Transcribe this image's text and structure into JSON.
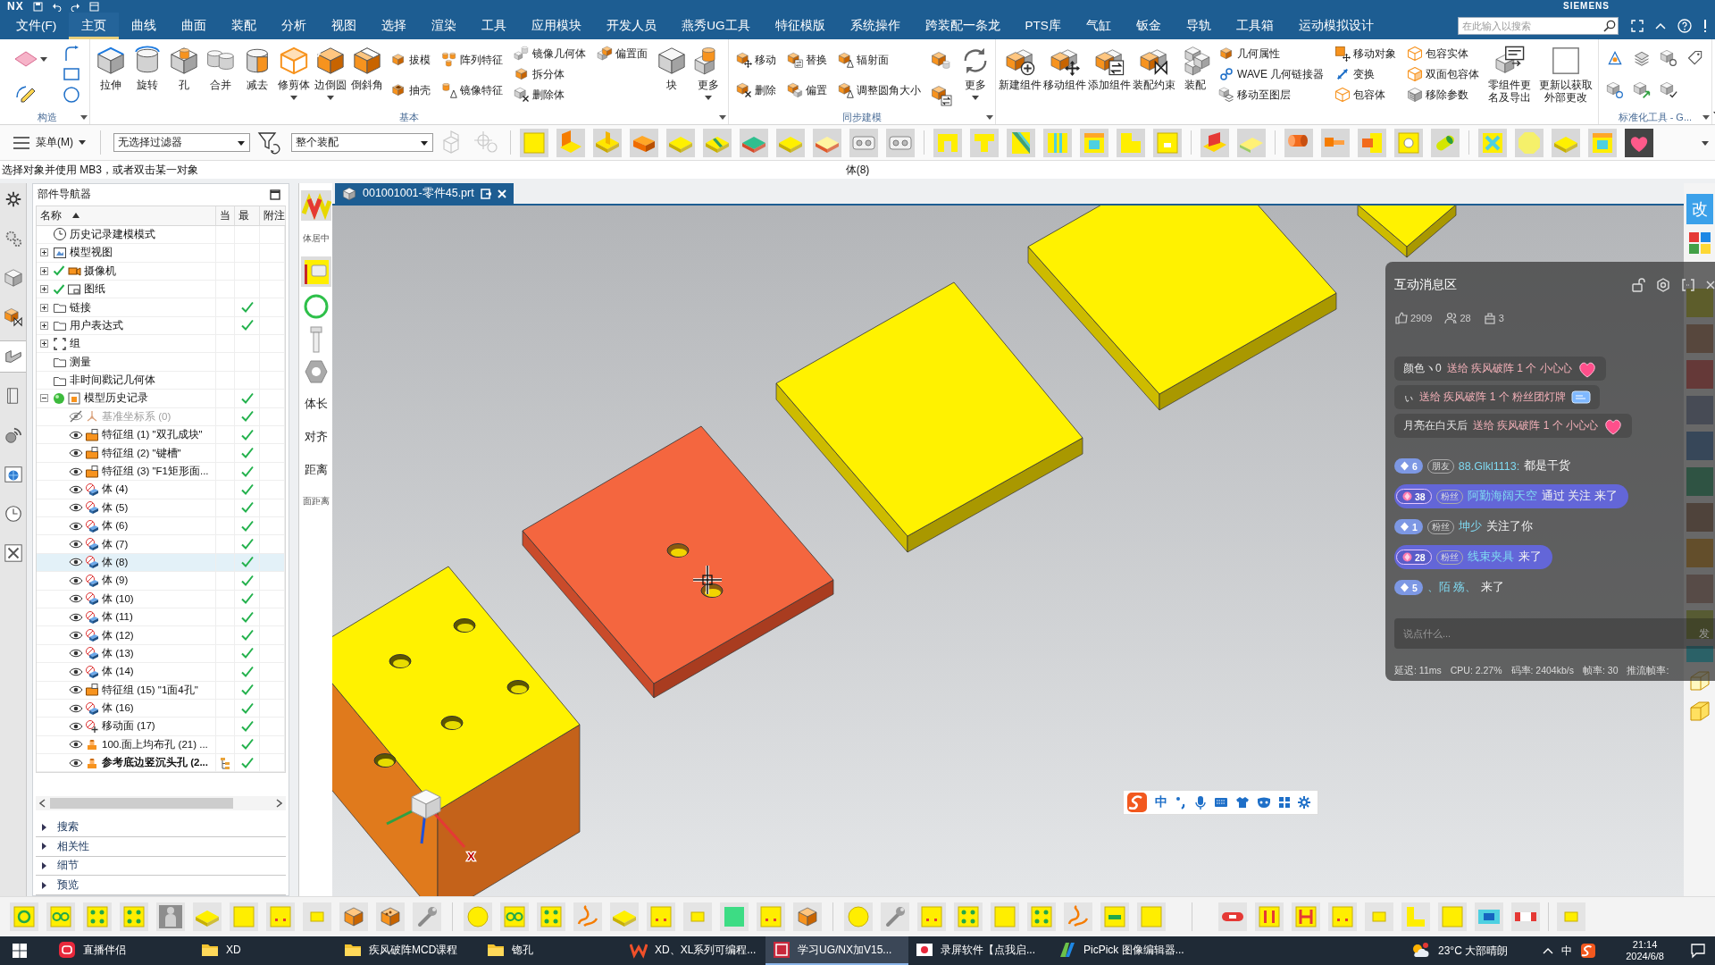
{
  "title_bar": {
    "logo": "NX",
    "brand": "SIEMENS"
  },
  "menu_tabs": [
    {
      "label": "文件(F)",
      "selected": false
    },
    {
      "label": "主页",
      "selected": true
    },
    {
      "label": "曲线",
      "selected": false
    },
    {
      "label": "曲面",
      "selected": false
    },
    {
      "label": "装配",
      "selected": false
    },
    {
      "label": "分析",
      "selected": false
    },
    {
      "label": "视图",
      "selected": false
    },
    {
      "label": "选择",
      "selected": false
    },
    {
      "label": "渲染",
      "selected": false
    },
    {
      "label": "工具",
      "selected": false
    },
    {
      "label": "应用模块",
      "selected": false
    },
    {
      "label": "开发人员",
      "selected": false
    },
    {
      "label": "燕秀UG工具",
      "selected": false
    },
    {
      "label": "特征模版",
      "selected": false
    },
    {
      "label": "系统操作",
      "selected": false
    },
    {
      "label": "跨装配一条龙",
      "selected": false
    },
    {
      "label": "PTS库",
      "selected": false
    },
    {
      "label": "气缸",
      "selected": false
    },
    {
      "label": "钣金",
      "selected": false
    },
    {
      "label": "导轨",
      "selected": false
    },
    {
      "label": "工具箱",
      "selected": false
    },
    {
      "label": "运动模拟设计",
      "selected": false
    }
  ],
  "search": {
    "placeholder": "在此输入以搜索"
  },
  "ribbon": {
    "groups": [
      {
        "kind": "sketch-tools",
        "label": "构造"
      },
      {
        "kind": "commands",
        "label": "基本",
        "columns": [
          {
            "kind": "large",
            "label": "拉伸",
            "dropdown": false
          },
          {
            "kind": "large",
            "label": "旋转",
            "dropdown": false
          },
          {
            "kind": "large",
            "label": "孔",
            "dropdown": false
          },
          {
            "kind": "large",
            "label": "合并",
            "dropdown": false
          },
          {
            "kind": "large",
            "label": "减去",
            "dropdown": false
          },
          {
            "kind": "large",
            "label": "修剪体",
            "dropdown": true
          },
          {
            "kind": "large",
            "label": "边倒圆",
            "dropdown": true
          },
          {
            "kind": "large",
            "label": "倒斜角",
            "dropdown": false
          },
          {
            "kind": "small",
            "items": [
              "拔模",
              "抽壳"
            ]
          },
          {
            "kind": "small",
            "items": [
              "阵列特征",
              "镜像特征"
            ]
          },
          {
            "kind": "small",
            "items": [
              "镜像几何体",
              "拆分体",
              "删除体"
            ]
          },
          {
            "kind": "small",
            "items": [
              "偏置面"
            ]
          },
          {
            "kind": "large",
            "label": "块",
            "dropdown": false
          },
          {
            "kind": "large",
            "label": "更多",
            "dropdown": true
          }
        ]
      },
      {
        "kind": "commands",
        "label": "同步建模",
        "columns": [
          {
            "kind": "small",
            "items": [
              "移动",
              "删除"
            ]
          },
          {
            "kind": "small",
            "items": [
              "替换",
              "偏置"
            ]
          },
          {
            "kind": "small",
            "items": [
              "辐射面",
              "调整圆角大小"
            ]
          },
          {
            "kind": "icons"
          },
          {
            "kind": "large",
            "label": "更多",
            "dropdown": true
          }
        ]
      },
      {
        "kind": "commands",
        "columns": [
          {
            "kind": "large",
            "label": "新建组件",
            "dropdown": false
          },
          {
            "kind": "large",
            "label": "移动组件",
            "dropdown": false
          },
          {
            "kind": "large",
            "label": "添加组件",
            "dropdown": false
          },
          {
            "kind": "large",
            "label": "装配约束",
            "dropdown": false
          },
          {
            "kind": "large",
            "label": "装配",
            "dropdown": false
          },
          {
            "kind": "small",
            "items": [
              "几何属性",
              "WAVE 几何链接器",
              "移动至图层"
            ]
          },
          {
            "kind": "small",
            "items": [
              "移动对象",
              "变换",
              "包容体"
            ]
          },
          {
            "kind": "small",
            "items": [
              "包容实体",
              "双面包容体",
              "移除参数"
            ]
          },
          {
            "kind": "large",
            "label": "零组件更名及导出",
            "dropdown": false
          },
          {
            "kind": "large",
            "label": "更新以获取外部更改",
            "dropdown": false
          }
        ]
      },
      {
        "kind": "standard-tools",
        "label": "标准化工具 - G..."
      }
    ]
  },
  "toolbar": {
    "menu": "菜单(M)",
    "filter": "无选择过滤器",
    "scope": "整个装配"
  },
  "status": {
    "prompt": "选择对象并使用 MB3，或者双击某一对象",
    "selection": "体(8)"
  },
  "resource_bar": [
    {
      "kind": "settings",
      "selected": false
    },
    {
      "kind": "gears",
      "selected": false
    },
    {
      "kind": "cube",
      "selected": false
    },
    {
      "kind": "assembly",
      "selected": false
    },
    {
      "kind": "part",
      "selected": true
    },
    {
      "kind": "book",
      "selected": false
    },
    {
      "kind": "library",
      "selected": false
    },
    {
      "kind": "web",
      "selected": false
    },
    {
      "kind": "history",
      "selected": false
    },
    {
      "kind": "tools",
      "selected": false
    }
  ],
  "navigator": {
    "title": "部件导航器",
    "columns": [
      "名称",
      "当",
      "最",
      "附注"
    ],
    "rows": [
      {
        "kind": "clock",
        "label": "历史记录建模模式",
        "checked": false,
        "latest": false,
        "selected": false
      },
      {
        "kind": "view",
        "label": "模型视图",
        "expanded": false,
        "checked": false,
        "latest": false,
        "selected": false
      },
      {
        "kind": "camera",
        "label": "摄像机",
        "expanded": false,
        "checked": true,
        "latest": false,
        "selected": false
      },
      {
        "kind": "drawing",
        "label": "图纸",
        "expanded": false,
        "checked": true,
        "latest": false,
        "selected": false
      },
      {
        "kind": "folder",
        "label": "链接",
        "expanded": false,
        "checked": false,
        "latest": true,
        "selected": false
      },
      {
        "kind": "folder",
        "label": "用户表达式",
        "expanded": false,
        "checked": false,
        "latest": true,
        "selected": false
      },
      {
        "kind": "group",
        "label": "组",
        "expanded": false,
        "checked": false,
        "latest": false,
        "selected": false
      },
      {
        "kind": "folder",
        "label": "测量",
        "checked": false,
        "latest": false,
        "selected": false
      },
      {
        "kind": "folder",
        "label": "非时间戳记几何体",
        "checked": false,
        "latest": false,
        "selected": false
      },
      {
        "kind": "history",
        "label": "模型历史记录",
        "expanded": true,
        "checked": false,
        "latest": true,
        "selected": false,
        "children": [
          {
            "kind": "datum",
            "label": "基准坐标系 (0)",
            "visible": false,
            "current": false,
            "latest": true,
            "selected": false
          },
          {
            "kind": "feature-group",
            "label": "特征组 (1) \"双孔成块\"",
            "visible": true,
            "current": false,
            "latest": true,
            "selected": false
          },
          {
            "kind": "feature-group",
            "label": "特征组 (2) \"键槽\"",
            "visible": true,
            "current": false,
            "latest": true,
            "selected": false
          },
          {
            "kind": "feature-group",
            "label": "特征组 (3) \"F1矩形面...",
            "visible": true,
            "current": false,
            "latest": true,
            "selected": false
          },
          {
            "kind": "body",
            "label": "体 (4)",
            "visible": true,
            "current": false,
            "latest": true,
            "selected": false
          },
          {
            "kind": "body",
            "label": "体 (5)",
            "visible": true,
            "current": false,
            "latest": true,
            "selected": false
          },
          {
            "kind": "body",
            "label": "体 (6)",
            "visible": true,
            "current": false,
            "latest": true,
            "selected": false
          },
          {
            "kind": "body",
            "label": "体 (7)",
            "visible": true,
            "current": false,
            "latest": true,
            "selected": false
          },
          {
            "kind": "body",
            "label": "体 (8)",
            "visible": true,
            "current": false,
            "latest": true,
            "selected": true
          },
          {
            "kind": "body",
            "label": "体 (9)",
            "visible": true,
            "current": false,
            "latest": true,
            "selected": false
          },
          {
            "kind": "body",
            "label": "体 (10)",
            "visible": true,
            "current": false,
            "latest": true,
            "selected": false
          },
          {
            "kind": "body",
            "label": "体 (11)",
            "visible": true,
            "current": false,
            "latest": true,
            "selected": false
          },
          {
            "kind": "body",
            "label": "体 (12)",
            "visible": true,
            "current": false,
            "latest": true,
            "selected": false
          },
          {
            "kind": "body",
            "label": "体 (13)",
            "visible": true,
            "current": false,
            "latest": true,
            "selected": false
          },
          {
            "kind": "body",
            "label": "体 (14)",
            "visible": true,
            "current": false,
            "latest": true,
            "selected": false
          },
          {
            "kind": "feature-group",
            "label": "特征组 (15) \"1面4孔\"",
            "visible": true,
            "current": false,
            "latest": true,
            "selected": false
          },
          {
            "kind": "body",
            "label": "体 (16)",
            "visible": true,
            "current": false,
            "latest": true,
            "selected": false
          },
          {
            "kind": "move-face",
            "label": "移动面 (17)",
            "visible": true,
            "current": false,
            "latest": true,
            "selected": false
          },
          {
            "kind": "hole",
            "label": "100.面上均布孔 (21) ...",
            "visible": true,
            "current": false,
            "latest": true,
            "selected": false
          },
          {
            "kind": "hole",
            "label": "参考底边竖沉头孔 (2...",
            "visible": true,
            "current": true,
            "latest": true,
            "selected": false
          }
        ]
      }
    ],
    "sections": [
      {
        "label": "搜索",
        "expanded": false
      },
      {
        "label": "相关性",
        "expanded": false
      },
      {
        "label": "细节",
        "expanded": false
      },
      {
        "label": "预览",
        "expanded": false
      }
    ]
  },
  "side_tools": [
    "体居中",
    "体长",
    "对齐",
    "距离",
    "面距离"
  ],
  "document_tab": {
    "label": "001001001-零件45.prt"
  },
  "viewport": {
    "bodies": [
      {
        "selected": false
      },
      {
        "selected": false
      },
      {
        "selected": false
      },
      {
        "selected": true
      },
      {
        "selected": false
      }
    ],
    "axis_label": "X"
  },
  "ime_bar": {
    "mode": "中"
  },
  "right_strip": {
    "label": "改"
  },
  "chat": {
    "title": "互动消息区",
    "stats": [
      {
        "kind": "likes",
        "value": "2909"
      },
      {
        "kind": "viewers",
        "value": "28"
      },
      {
        "kind": "gifts",
        "value": "3"
      }
    ],
    "gifts": [
      {
        "kind": "heart",
        "user": "颜色ヽ0",
        "text": "送给 疾风破阵 1 个 小心心"
      },
      {
        "kind": "light-card",
        "user": "ぃ",
        "text": "送给 疾风破阵 1 个 粉丝团灯牌"
      },
      {
        "kind": "heart",
        "user": "月亮在白天后",
        "text": "送给 疾风破阵 1 个 小心心"
      }
    ],
    "messages": [
      {
        "kind": "chat",
        "rank": "6",
        "tag": "朋友",
        "user": "88.Glkl1113:",
        "text": "都是干货"
      },
      {
        "kind": "entry",
        "rank": "38",
        "tag": "粉丝",
        "user": "阿勤海阔天空",
        "text": "通过 关注 来了"
      },
      {
        "kind": "chat",
        "rank": "1",
        "tag": "粉丝",
        "user": "坤少",
        "text": "关注了你"
      },
      {
        "kind": "entry",
        "rank": "28",
        "tag": "粉丝",
        "user": "线束夹具",
        "text": "来了"
      },
      {
        "kind": "chat",
        "rank": "5",
        "user": "、陌 殇、",
        "text": "来了"
      }
    ],
    "input": {
      "placeholder": "说点什么..."
    },
    "send": "发",
    "metrics": [
      "延迟: 11ms",
      "CPU: 2.27%",
      "码率: 2404kb/s",
      "帧率: 30",
      "推流帧率:"
    ]
  },
  "taskbar": {
    "apps": [
      {
        "kind": "live",
        "label": "直播伴侣",
        "selected": false
      },
      {
        "kind": "folder",
        "label": "XD",
        "selected": false
      },
      {
        "kind": "folder",
        "label": "疾风破阵MCD课程",
        "selected": false
      },
      {
        "kind": "folder",
        "label": "锪孔",
        "selected": false
      },
      {
        "kind": "xd",
        "label": "XD、XL系列可编程...",
        "selected": false
      },
      {
        "kind": "nx",
        "label": "学习UG/NX加V15...",
        "selected": true
      },
      {
        "kind": "recorder",
        "label": "录屏软件【点我启...",
        "selected": false
      },
      {
        "kind": "picpick",
        "label": "PicPick 图像编辑器...",
        "selected": false
      }
    ],
    "weather": "23°C 大部晴朗",
    "ime": "中",
    "time": "21:14",
    "date": "2024/6/8"
  }
}
